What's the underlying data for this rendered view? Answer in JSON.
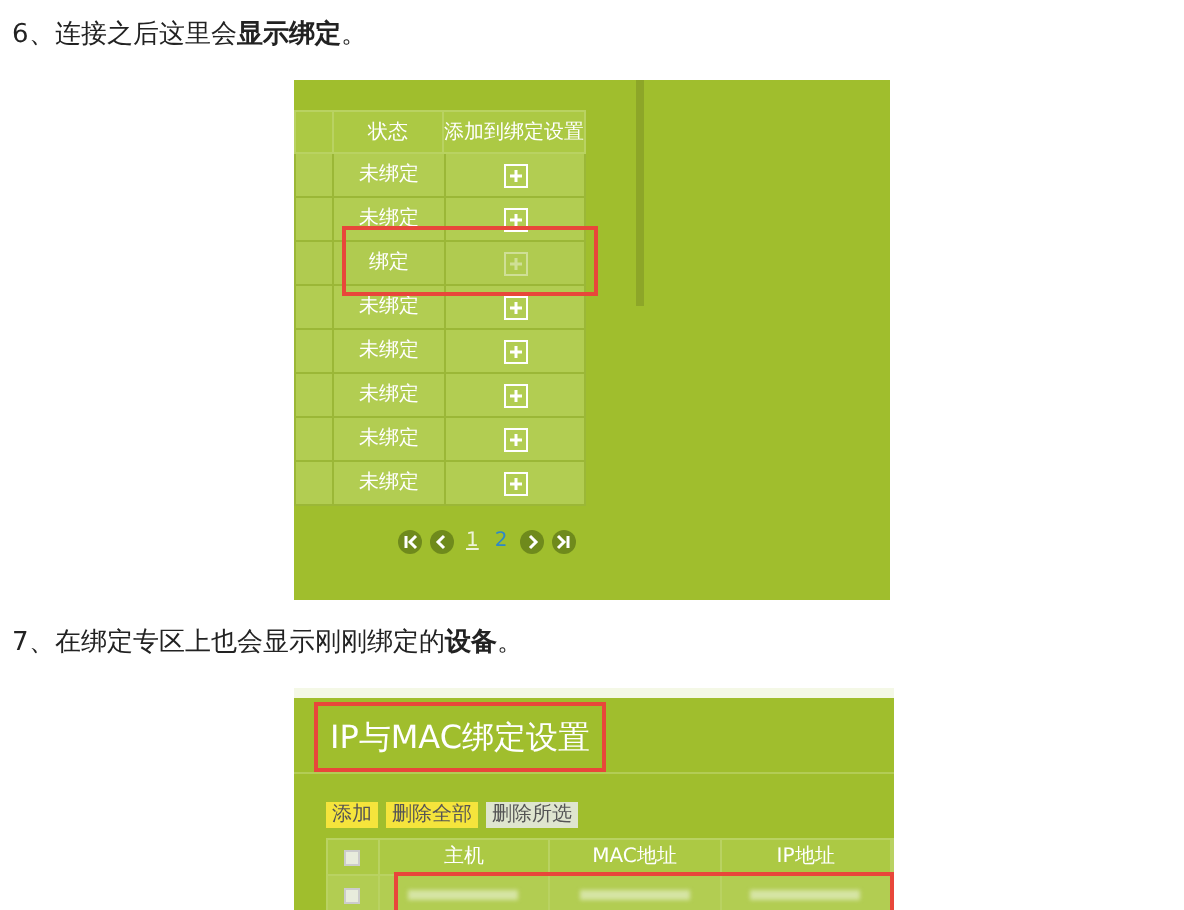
{
  "steps": [
    {
      "number": "6、",
      "text": "连接之后这里会**显示绑定**。"
    },
    {
      "number": "7、",
      "text": "在绑定专区上也会显示刚刚绑定的**设备**。"
    }
  ],
  "bind_list": {
    "columns": [
      "状态",
      "添加到绑定设置"
    ],
    "rows": [
      {
        "status": "未绑定",
        "bound": false,
        "highlight": false
      },
      {
        "status": "未绑定",
        "bound": false,
        "highlight": false
      },
      {
        "status": "绑定",
        "bound": true,
        "highlight": true
      },
      {
        "status": "未绑定",
        "bound": false,
        "highlight": false
      },
      {
        "status": "未绑定",
        "bound": false,
        "highlight": false
      },
      {
        "status": "未绑定",
        "bound": false,
        "highlight": false
      },
      {
        "status": "未绑定",
        "bound": false,
        "highlight": false
      },
      {
        "status": "未绑定",
        "bound": false,
        "highlight": false
      }
    ],
    "pages": [
      {
        "label": "1",
        "selected": true
      },
      {
        "label": "2",
        "selected": false
      }
    ]
  },
  "binding_settings": {
    "title": "IP与MAC绑定设置",
    "title_highlight": true,
    "buttons": [
      {
        "label": "添加",
        "kind": "primary"
      },
      {
        "label": "删除全部",
        "kind": "primary"
      },
      {
        "label": "删除所选",
        "kind": "secondary"
      }
    ],
    "columns": [
      "主机",
      "MAC地址",
      "IP地址"
    ],
    "header_checked": false,
    "row_checked": false,
    "row_highlight": true
  }
}
